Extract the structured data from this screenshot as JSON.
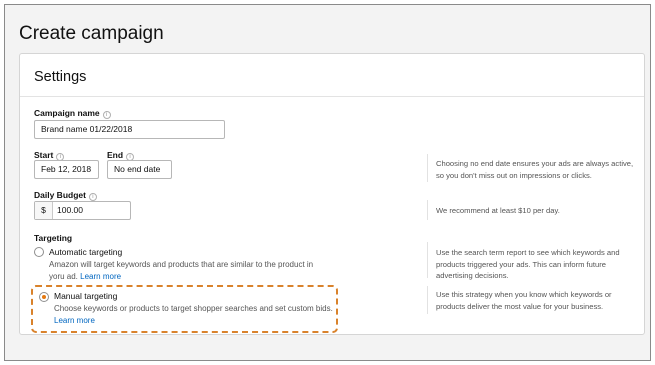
{
  "page": {
    "title": "Create campaign"
  },
  "settings": {
    "title": "Settings",
    "campaign_name": {
      "label": "Campaign name",
      "value": "Brand name 01/22/2018"
    },
    "start": {
      "label": "Start",
      "value": "Feb 12, 2018"
    },
    "end": {
      "label": "End",
      "value": "No end date"
    },
    "end_hint": "Choosing no end date ensures your ads are always active, so you don't miss out on impressions or clicks.",
    "daily_budget": {
      "label": "Daily Budget",
      "currency": "$",
      "value": "100.00"
    },
    "budget_hint": "We recommend at least $10 per day.",
    "targeting": {
      "label": "Targeting",
      "automatic": {
        "title": "Automatic targeting",
        "desc": "Amazon will target keywords and products that are similar to the product in yoru ad.",
        "link": "Learn more",
        "hint": "Use the search term report to see which keywords and products triggered your ads. This can inform future advertising decisions.",
        "selected": false
      },
      "manual": {
        "title": "Manual targeting",
        "desc": "Choose keywords or products to target shopper searches and set custom bids.",
        "link": "Learn more",
        "hint": "Use this strategy when you know which keywords or products deliver the most value for your business.",
        "selected": true
      }
    }
  },
  "icons": {
    "info": "info-icon"
  },
  "colors": {
    "accent": "#e47911",
    "link": "#0066c0",
    "highlight": "#d9822b"
  }
}
